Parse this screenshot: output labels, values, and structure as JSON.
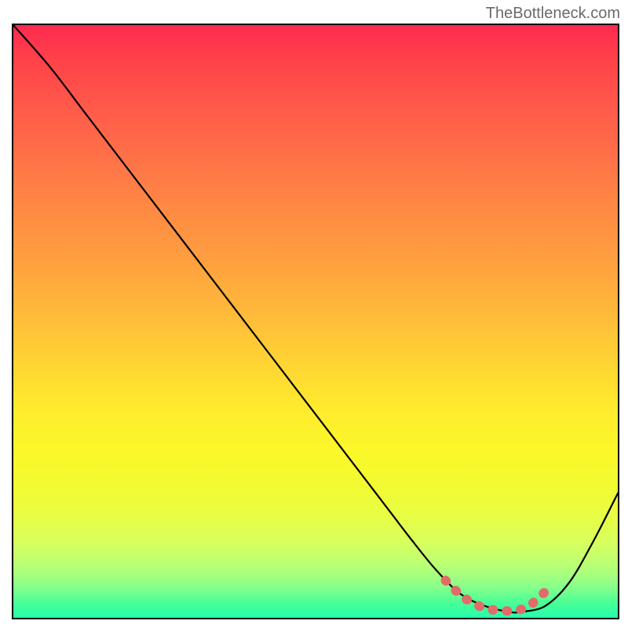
{
  "attribution": "TheBottleneck.com",
  "chart_data": {
    "type": "line",
    "title": "",
    "xlabel": "",
    "ylabel": "",
    "xlim": [
      0,
      100
    ],
    "ylim": [
      0,
      100
    ],
    "series": [
      {
        "name": "curve",
        "x": [
          0,
          6,
          12,
          18,
          24,
          30,
          36,
          42,
          48,
          54,
          60,
          66,
          70,
          74,
          78,
          82,
          84,
          88,
          92,
          96,
          100
        ],
        "y": [
          100,
          93,
          85,
          77,
          69,
          61,
          53,
          45,
          37,
          29,
          21,
          13,
          8,
          4,
          2,
          1,
          1,
          2,
          6,
          13,
          21
        ]
      }
    ],
    "highlight": {
      "name": "optimal-zone",
      "x": [
        71.5,
        73.5,
        75,
        77,
        79,
        81,
        83,
        85,
        86.5,
        88.5
      ],
      "y": [
        6.3,
        4.3,
        3.1,
        2.0,
        1.4,
        1.2,
        1.2,
        1.8,
        3.0,
        4.9
      ]
    },
    "gradient_stops": [
      {
        "pos": 0,
        "color": "#ff2a4f"
      },
      {
        "pos": 50,
        "color": "#ffc838"
      },
      {
        "pos": 80,
        "color": "#f2fb32"
      },
      {
        "pos": 100,
        "color": "#24ffac"
      }
    ]
  }
}
